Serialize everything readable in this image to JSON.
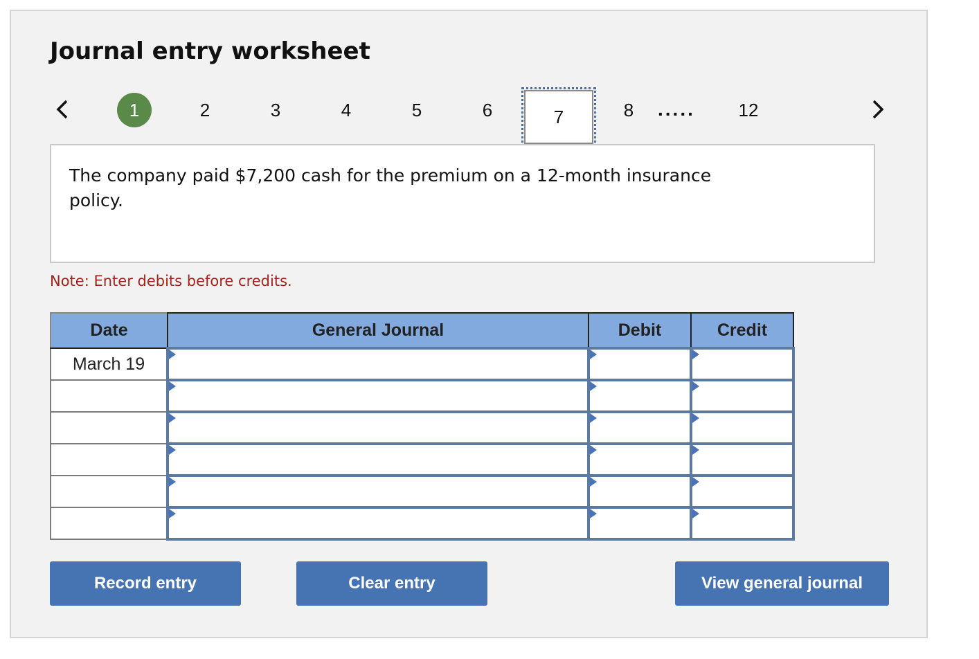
{
  "title": "Journal entry worksheet",
  "pager": {
    "prev_icon": "chevron-left-icon",
    "next_icon": "chevron-right-icon",
    "steps": [
      "1",
      "2",
      "3",
      "4",
      "5",
      "6",
      "7",
      "8",
      "12"
    ],
    "active_step": "1",
    "focused_step": "7",
    "ellipsis": ".....",
    "active_color": "#5a8a4a"
  },
  "question": "The company paid $7,200 cash for the premium on a 12-month insurance policy.",
  "note": "Note: Enter debits before credits.",
  "journal": {
    "headers": {
      "date": "Date",
      "general_journal": "General Journal",
      "debit": "Debit",
      "credit": "Credit"
    },
    "rows": [
      {
        "date": "March 19",
        "account": "",
        "debit": "",
        "credit": ""
      },
      {
        "date": "",
        "account": "",
        "debit": "",
        "credit": ""
      },
      {
        "date": "",
        "account": "",
        "debit": "",
        "credit": ""
      },
      {
        "date": "",
        "account": "",
        "debit": "",
        "credit": ""
      },
      {
        "date": "",
        "account": "",
        "debit": "",
        "credit": ""
      },
      {
        "date": "",
        "account": "",
        "debit": "",
        "credit": ""
      }
    ],
    "header_color": "#82aadf"
  },
  "buttons": {
    "record": "Record entry",
    "clear": "Clear entry",
    "view": "View general journal",
    "color": "#4673b2"
  }
}
